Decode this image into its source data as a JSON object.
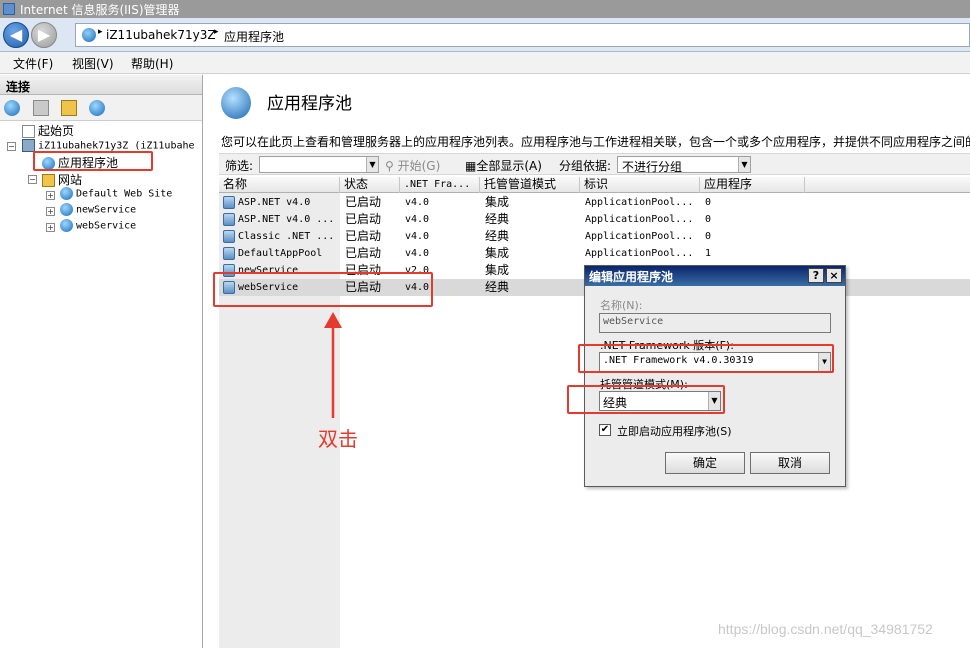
{
  "window": {
    "title": "Internet 信息服务(IIS)管理器"
  },
  "address": {
    "segments": [
      "iZ11ubahek71y3Z",
      "应用程序池"
    ]
  },
  "menu": {
    "items": [
      "文件(F)",
      "视图(V)",
      "帮助(H)"
    ]
  },
  "connections": {
    "header": "连接",
    "tree": {
      "start_page": "起始页",
      "server": "iZ11ubahek71y3Z (iZ11ubahe",
      "app_pools": "应用程序池",
      "sites": "网站",
      "site_list": [
        "Default Web Site",
        "newService",
        "webService"
      ]
    }
  },
  "main": {
    "title": "应用程序池",
    "description": "您可以在此页上查看和管理服务器上的应用程序池列表。应用程序池与工作进程相关联，包含一个或多个应用程序，并提供不同应用程序之间的",
    "filter": {
      "label": "筛选:",
      "start_label": "开始(G)",
      "show_all_label": "全部显示(A)",
      "group_label": "分组依据:",
      "group_value": "不进行分组"
    },
    "columns": [
      "名称",
      "状态",
      ".NET Fra...",
      "托管管道模式",
      "标识",
      "应用程序"
    ],
    "rows": [
      {
        "name": "ASP.NET v4.0",
        "status": "已启动",
        "net": "v4.0",
        "pipeline": "集成",
        "identity": "ApplicationPool...",
        "apps": "0"
      },
      {
        "name": "ASP.NET v4.0 ...",
        "status": "已启动",
        "net": "v4.0",
        "pipeline": "经典",
        "identity": "ApplicationPool...",
        "apps": "0"
      },
      {
        "name": "Classic .NET ...",
        "status": "已启动",
        "net": "v4.0",
        "pipeline": "经典",
        "identity": "ApplicationPool...",
        "apps": "0"
      },
      {
        "name": "DefaultAppPool",
        "status": "已启动",
        "net": "v4.0",
        "pipeline": "集成",
        "identity": "ApplicationPool...",
        "apps": "1"
      },
      {
        "name": "newService",
        "status": "已启动",
        "net": "v2.0",
        "pipeline": "集成",
        "identity": "",
        "apps": ""
      },
      {
        "name": "webService",
        "status": "已启动",
        "net": "v4.0",
        "pipeline": "经典",
        "identity": "",
        "apps": ""
      }
    ]
  },
  "dialog": {
    "title": "编辑应用程序池",
    "help_btn": "?",
    "close_btn": "×",
    "name_label": "名称(N):",
    "name_value": "webService",
    "framework_label": ".NET Framework 版本(F):",
    "framework_value": ".NET Framework v4.0.30319",
    "pipeline_label": "托管管道模式(M):",
    "pipeline_value": "经典",
    "autostart_label": "立即启动应用程序池(S)",
    "autostart_checked": true,
    "ok_label": "确定",
    "cancel_label": "取消"
  },
  "annotation": {
    "text": "双击",
    "color": "#e53a2e"
  },
  "watermark": "https://blog.csdn.net/qq_34981752"
}
